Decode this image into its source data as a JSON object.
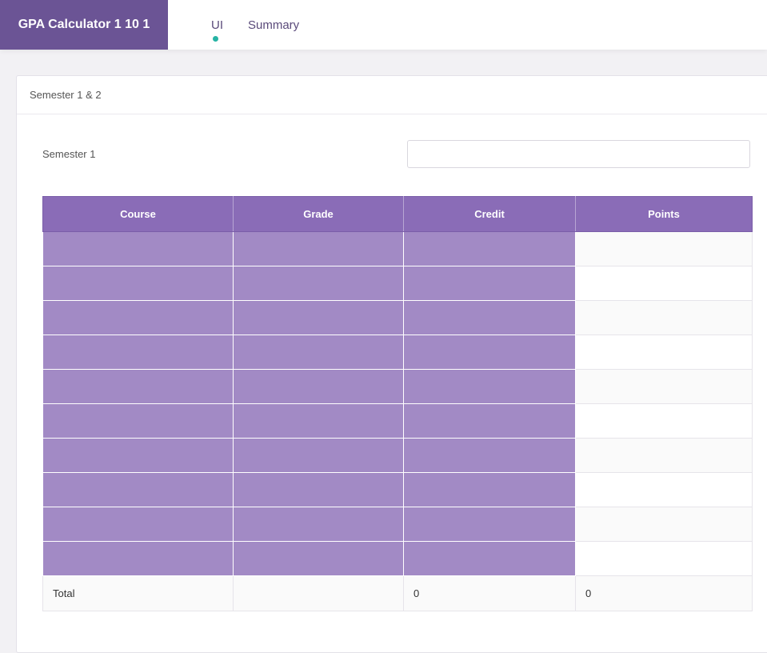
{
  "app": {
    "title": "GPA Calculator 1 10 1"
  },
  "tabs": [
    {
      "label": "UI",
      "active": true
    },
    {
      "label": "Summary",
      "active": false
    }
  ],
  "card": {
    "title": "Semester 1 & 2"
  },
  "semester": {
    "label": "Semester 1",
    "input_value": "",
    "input_placeholder": ""
  },
  "table": {
    "headers": [
      "Course",
      "Grade",
      "Credit",
      "Points"
    ],
    "rows": [
      {
        "course": "",
        "grade": "",
        "credit": "",
        "points": ""
      },
      {
        "course": "",
        "grade": "",
        "credit": "",
        "points": ""
      },
      {
        "course": "",
        "grade": "",
        "credit": "",
        "points": ""
      },
      {
        "course": "",
        "grade": "",
        "credit": "",
        "points": ""
      },
      {
        "course": "",
        "grade": "",
        "credit": "",
        "points": ""
      },
      {
        "course": "",
        "grade": "",
        "credit": "",
        "points": ""
      },
      {
        "course": "",
        "grade": "",
        "credit": "",
        "points": ""
      },
      {
        "course": "",
        "grade": "",
        "credit": "",
        "points": ""
      },
      {
        "course": "",
        "grade": "",
        "credit": "",
        "points": ""
      },
      {
        "course": "",
        "grade": "",
        "credit": "",
        "points": ""
      }
    ],
    "total": {
      "label": "Total",
      "grade": "",
      "credit": "0",
      "points": "0"
    }
  },
  "colors": {
    "brand": "#6b5495",
    "header": "#8a6cb7",
    "cell_fill": "#a28ac5",
    "tab_indicator": "#26b3a4"
  }
}
